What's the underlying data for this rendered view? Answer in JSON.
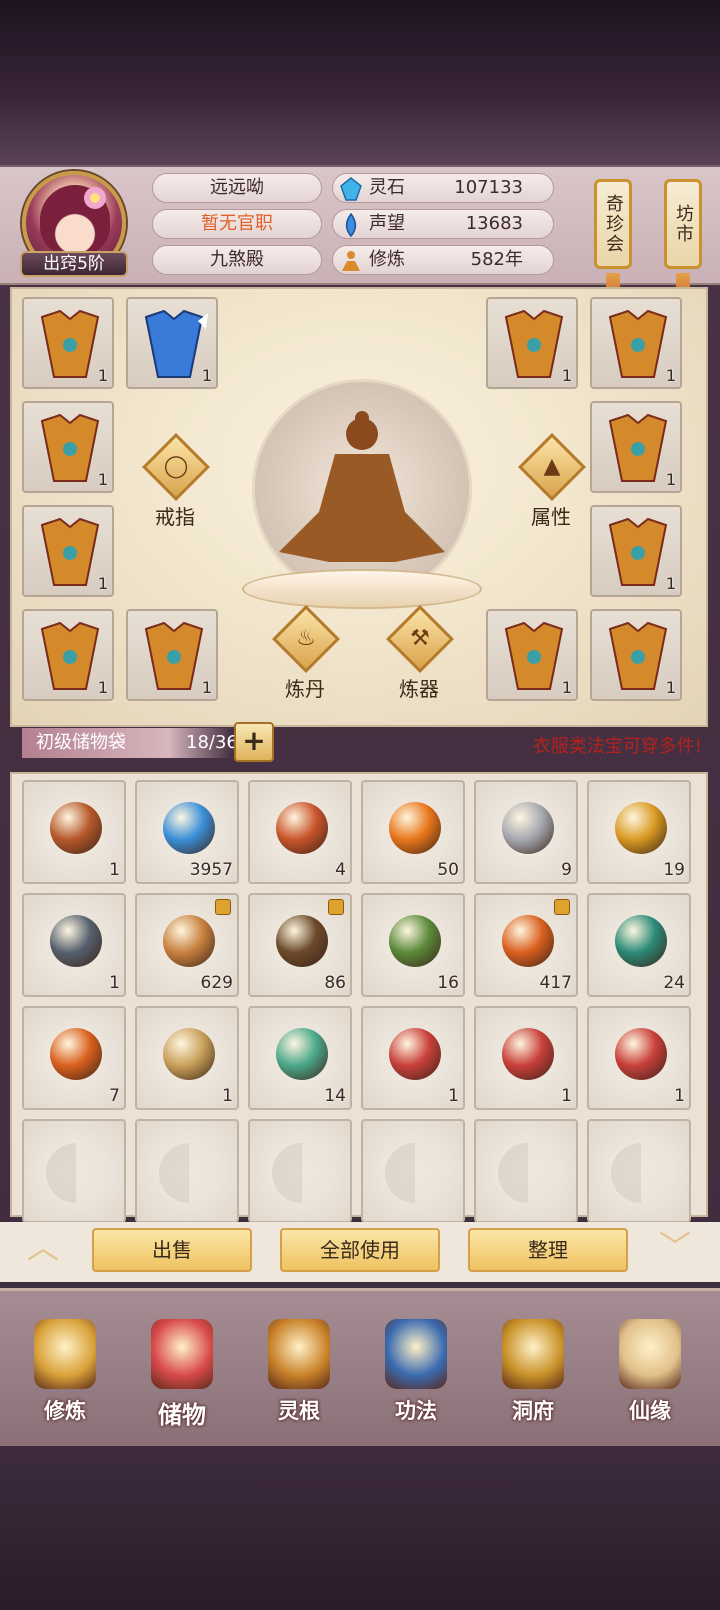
{
  "profile": {
    "name": "远远呦",
    "title": "暂无官职",
    "sect": "九煞殿",
    "rank": "出窍5阶"
  },
  "resources": [
    {
      "label": "灵石",
      "value": "107133",
      "icon": "spirit-stone-icon"
    },
    {
      "label": "声望",
      "value": "13683",
      "icon": "prestige-icon"
    },
    {
      "label": "修炼",
      "value": "582年",
      "icon": "cultivation-icon"
    }
  ],
  "side_buttons": {
    "treasure_fair": "奇珍会",
    "market": "坊市"
  },
  "equipment": {
    "slots": [
      {
        "count": "1"
      },
      {
        "count": "1"
      },
      {
        "count": "1"
      },
      {
        "count": "1"
      },
      {
        "count": "1"
      },
      {
        "count": "1"
      },
      {
        "count": "1"
      },
      {
        "count": "1"
      },
      {
        "count": "1"
      },
      {
        "count": "1"
      },
      {
        "count": "1"
      },
      {
        "count": "1"
      }
    ],
    "ring_label": "戒指",
    "attr_label": "属性",
    "alchemy_label": "炼丹",
    "forge_label": "炼器"
  },
  "storage": {
    "bag_name": "初级储物袋",
    "capacity": "18/36",
    "add_symbol": "+",
    "hint": "衣服类法宝可穿多件!"
  },
  "inventory": [
    {
      "icon": "ring-icon",
      "count": "1",
      "locked": false,
      "color": "#b5582a"
    },
    {
      "icon": "blue-crystal-icon",
      "count": "3957",
      "locked": false,
      "color": "#3a8fd8"
    },
    {
      "icon": "red-orb-icon",
      "count": "4",
      "locked": false,
      "color": "#c9552a"
    },
    {
      "icon": "orange-orb-icon",
      "count": "50",
      "locked": false,
      "color": "#e8761a"
    },
    {
      "icon": "silver-ore-icon",
      "count": "9",
      "locked": false,
      "color": "#a6a8b0"
    },
    {
      "icon": "gold-ore-icon",
      "count": "19",
      "locked": false,
      "color": "#d99a22"
    },
    {
      "icon": "iron-ore-icon",
      "count": "1",
      "locked": false,
      "color": "#56606e"
    },
    {
      "icon": "ginseng-icon",
      "count": "629",
      "locked": true,
      "color": "#c8813e"
    },
    {
      "icon": "herb-root-icon",
      "count": "86",
      "locked": true,
      "color": "#6b4a2a"
    },
    {
      "icon": "flower-herb-icon",
      "count": "16",
      "locked": false,
      "color": "#5a8a3a"
    },
    {
      "icon": "cordyceps-icon",
      "count": "417",
      "locked": true,
      "color": "#d9601e"
    },
    {
      "icon": "jade-gourd-icon",
      "count": "24",
      "locked": false,
      "color": "#2a8a78"
    },
    {
      "icon": "fire-gourd-icon",
      "count": "7",
      "locked": false,
      "color": "#d9601e"
    },
    {
      "icon": "pouch-icon",
      "count": "1",
      "locked": false,
      "color": "#c9a05a"
    },
    {
      "icon": "jade-stone-icon",
      "count": "14",
      "locked": false,
      "color": "#4aa88a"
    },
    {
      "icon": "scroll-icon",
      "count": "1",
      "locked": false,
      "color": "#c8403a"
    },
    {
      "icon": "scroll-icon",
      "count": "1",
      "locked": false,
      "color": "#c8403a"
    },
    {
      "icon": "scroll-icon",
      "count": "1",
      "locked": false,
      "color": "#c8403a"
    }
  ],
  "actions": {
    "sell": "出售",
    "use_all": "全部使用",
    "organize": "整理"
  },
  "nav": [
    {
      "label": "修炼",
      "icon": "cultivation-nav-icon",
      "active": false
    },
    {
      "label": "储物",
      "icon": "storage-bag-icon",
      "active": true
    },
    {
      "label": "灵根",
      "icon": "spirit-root-icon",
      "active": false
    },
    {
      "label": "功法",
      "icon": "technique-book-icon",
      "active": false
    },
    {
      "label": "洞府",
      "icon": "cave-dwelling-icon",
      "active": false
    },
    {
      "label": "仙缘",
      "icon": "immortal-fate-icon",
      "active": false
    }
  ]
}
